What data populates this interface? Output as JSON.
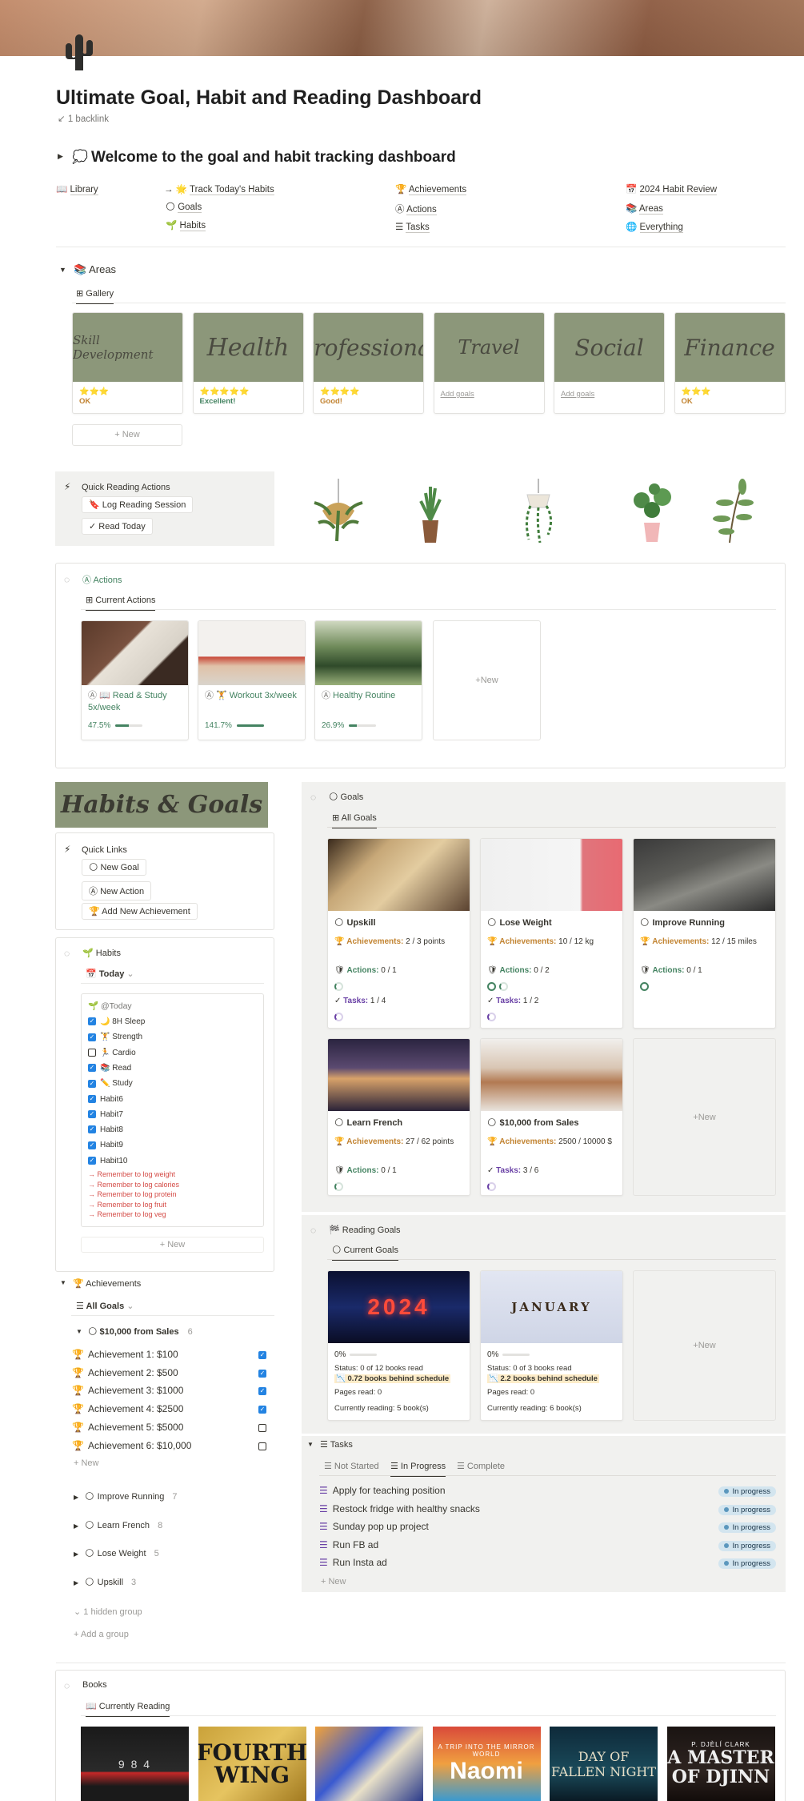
{
  "page": {
    "title": "Ultimate Goal, Habit and Reading Dashboard",
    "backlink": "1 backlink"
  },
  "welcome": {
    "heading": "Welcome to the goal and habit tracking dashboard"
  },
  "nav": {
    "col1": [
      "Library"
    ],
    "col2": [
      "Track Today's Habits",
      "Goals",
      "Habits"
    ],
    "col3": [
      "Achievements",
      "Actions",
      "Tasks"
    ],
    "col4": [
      "2024 Habit Review",
      "Areas",
      "Everything"
    ]
  },
  "areas": {
    "heading": "Areas",
    "tab": "Gallery",
    "new_label": "New",
    "cards": [
      {
        "name": "Skill Development",
        "stars": "⭐⭐⭐",
        "rating": "OK",
        "rating_color": "#c28432"
      },
      {
        "name": "Health",
        "stars": "⭐⭐⭐⭐⭐",
        "rating": "Excellent!",
        "rating_color": "#448361"
      },
      {
        "name": "Professional",
        "stars": "⭐⭐⭐⭐",
        "rating": "Good!",
        "rating_color": "#c28432"
      },
      {
        "name": "Travel",
        "stars": "",
        "rating": "Add goals",
        "rating_color": "#9b9a97"
      },
      {
        "name": "Social",
        "stars": "",
        "rating": "Add goals",
        "rating_color": "#9b9a97"
      },
      {
        "name": "Finance",
        "stars": "⭐⭐⭐",
        "rating": "OK",
        "rating_color": "#c28432"
      }
    ]
  },
  "quick_reading": {
    "heading": "Quick Reading Actions",
    "buttons": [
      "Log Reading Session",
      "Read Today"
    ]
  },
  "actions": {
    "heading": "Actions",
    "tab": "Current Actions",
    "new_label": "New",
    "cards": [
      {
        "title": "📖 Read & Study 5x/week",
        "percent": "47.5%",
        "progress": 0.475
      },
      {
        "title": "🏋 Workout 3x/week",
        "percent": "141.7%",
        "progress": 1.0
      },
      {
        "title": "Healthy Routine",
        "percent": "26.9%",
        "progress": 0.269
      }
    ]
  },
  "habits_goals_banner": "Habits & Goals",
  "quick_links": {
    "heading": "Quick Links",
    "buttons": [
      "New Goal",
      "New Action",
      "Add New Achievement"
    ]
  },
  "habits": {
    "heading": "Habits",
    "view": "Today",
    "card_title": "@Today",
    "items": [
      {
        "label": "🌙 8H Sleep",
        "checked": true
      },
      {
        "label": "🏋 Strength",
        "checked": true
      },
      {
        "label": "🏃 Cardio",
        "checked": false
      },
      {
        "label": "📚 Read",
        "checked": true
      },
      {
        "label": "✏️ Study",
        "checked": true
      },
      {
        "label": "Habit6",
        "checked": true
      },
      {
        "label": "Habit7",
        "checked": true
      },
      {
        "label": "Habit8",
        "checked": true
      },
      {
        "label": "Habit9",
        "checked": true
      },
      {
        "label": "Habit10",
        "checked": true
      }
    ],
    "reminders": [
      "→ Remember to log weight",
      "→ Remember to log calories",
      "→ Remember to log protein",
      "→ Remember to log fruit",
      "→ Remember to log veg"
    ],
    "new_label": "New"
  },
  "achievements": {
    "heading": "Achievements",
    "view": "All Goals",
    "open_group": {
      "name": "$10,000 from Sales",
      "count": "6"
    },
    "items": [
      {
        "label": "Achievement 1: $100",
        "checked": true
      },
      {
        "label": "Achievement 2: $500",
        "checked": true
      },
      {
        "label": "Achievement 3: $1000",
        "checked": true
      },
      {
        "label": "Achievement 4: $2500",
        "checked": true
      },
      {
        "label": "Achievement 5: $5000",
        "checked": false
      },
      {
        "label": "Achievement 6: $10,000",
        "checked": false
      }
    ],
    "new_label": "New",
    "groups": [
      {
        "name": "Improve Running",
        "count": "7"
      },
      {
        "name": "Learn French",
        "count": "8"
      },
      {
        "name": "Lose Weight",
        "count": "5"
      },
      {
        "name": "Upskill",
        "count": "3"
      }
    ],
    "hidden_group": "1 hidden group",
    "add_group": "Add a group"
  },
  "goals": {
    "heading": "Goals",
    "tab": "All Goals",
    "new_label": "New",
    "ach_label": "Achievements:",
    "act_label": "Actions:",
    "task_label": "Tasks:",
    "cards": [
      {
        "title": "Upskill",
        "ach": "2 / 3 points",
        "act": "0 / 1",
        "tasks": "1 / 4",
        "ach_p": 0.67
      },
      {
        "title": "Lose Weight",
        "ach": "10 / 12 kg",
        "act": "0 / 2",
        "tasks": "1 / 2",
        "ach_p": 0.83
      },
      {
        "title": "Improve Running",
        "ach": "12 / 15 miles",
        "act": "0 / 1",
        "tasks": "",
        "ach_p": 0.8
      },
      {
        "title": "Learn French",
        "ach": "27 / 62 points",
        "act": "0 / 1",
        "tasks": "",
        "ach_p": 0.44
      },
      {
        "title": "$10,000 from Sales",
        "ach": "2500 / 10000 $",
        "act": "",
        "tasks": "3 / 6",
        "ach_p": 0.25
      }
    ]
  },
  "reading_goals": {
    "heading": "Reading Goals",
    "tab": "Current Goals",
    "new_label": "New",
    "cards": [
      {
        "img_text": "2024",
        "percent": "0%",
        "status": "Status: 0 of 12 books read",
        "behind": "📉 0.72 books behind schedule",
        "pages": "Pages read: 0",
        "current": "Currently reading: 5 book(s)"
      },
      {
        "img_text": "JANUARY",
        "percent": "0%",
        "status": "Status: 0 of 3 books read",
        "behind": "📉 2.2 books behind schedule",
        "pages": "Pages read: 0",
        "current": "Currently reading: 6 book(s)"
      }
    ]
  },
  "tasks": {
    "heading": "Tasks",
    "tabs": [
      "Not Started",
      "In Progress",
      "Complete"
    ],
    "items": [
      "Apply for teaching position",
      "Restock fridge with healthy snacks",
      "Sunday pop up project",
      "Run FB ad",
      "Run Insta ad"
    ],
    "status": "In progress",
    "new_label": "New"
  },
  "books": {
    "heading": "Books",
    "tab": "Currently Reading",
    "covers": [
      "9 8 4",
      "FOURTH WING",
      "",
      "Naomi",
      "DAY OF FALLEN NIGHT",
      "A MASTER OF DJINN"
    ],
    "cover_sub": [
      "",
      "",
      "",
      "A TRIP INTO THE MIRROR WORLD",
      "",
      "P. DJÈLÍ CLARK"
    ]
  }
}
